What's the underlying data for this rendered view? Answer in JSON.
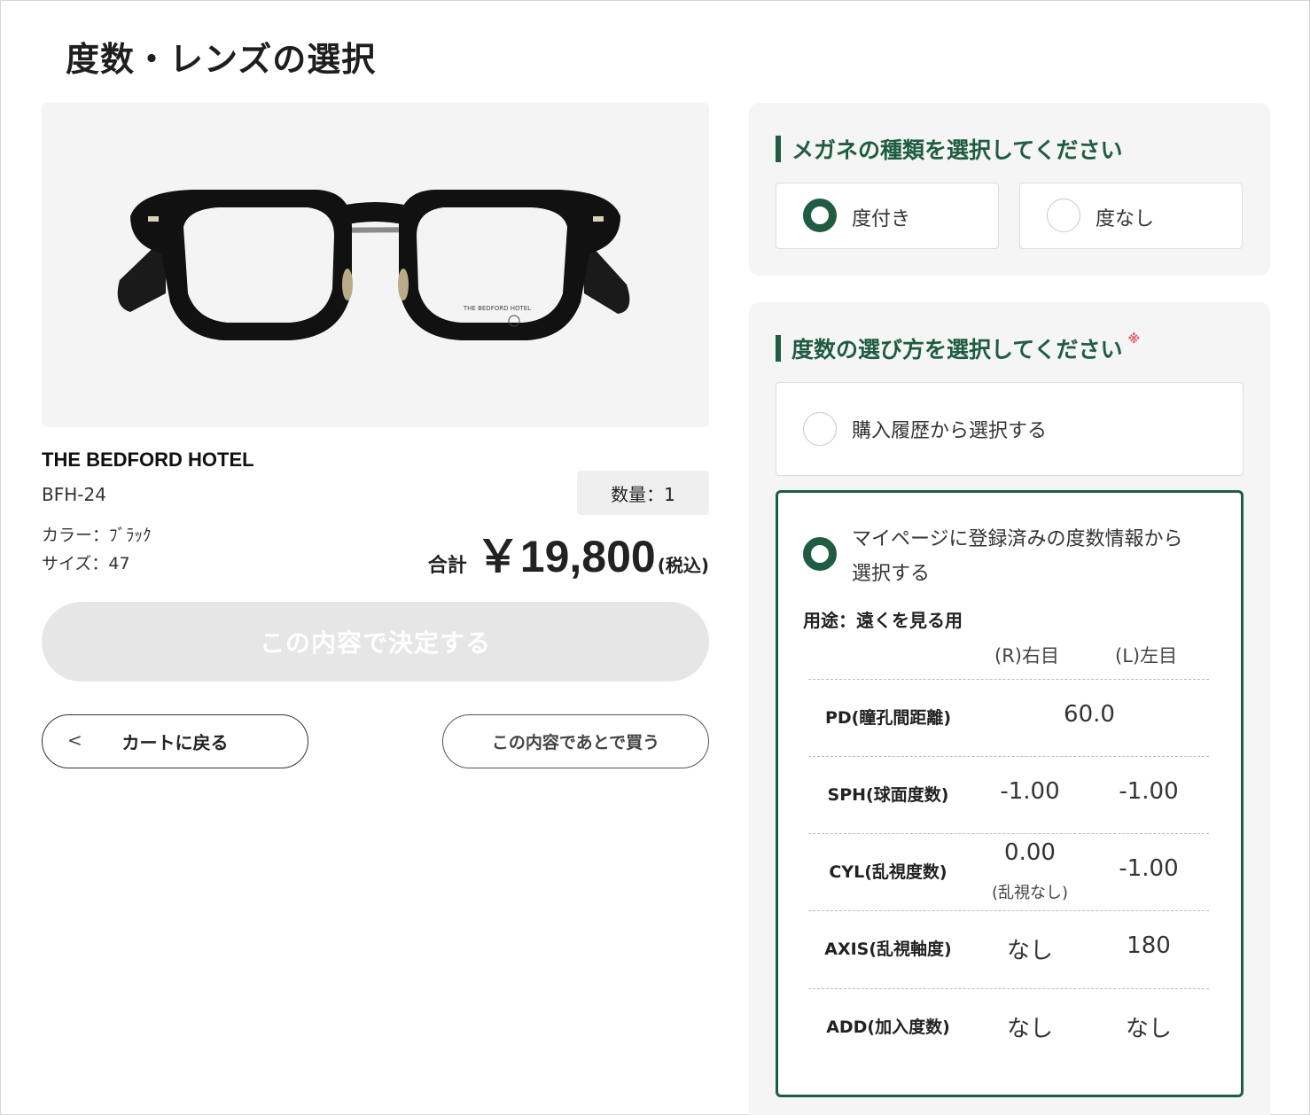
{
  "page": {
    "title": "度数・レンズの選択"
  },
  "product": {
    "image_logo_text": "THE BEDFORD HOTEL",
    "brand": "THE BEDFORD HOTEL",
    "model": "BFH-24",
    "color": "カラー：ﾌﾞﾗｯｸ",
    "size": "サイズ：47",
    "quantity": "数量：1",
    "price_label": "合計",
    "price": "￥19,800",
    "price_tax": "(税込)"
  },
  "actions": {
    "confirm_label": "この内容で決定する",
    "back_label": "カートに戻る",
    "back_chevron": "<",
    "buy_later_label": "この内容であとで買う"
  },
  "glasses_type": {
    "heading": "メガネの種類を選択してください",
    "options": [
      {
        "label": "度付き",
        "selected": true
      },
      {
        "label": "度なし",
        "selected": false
      }
    ]
  },
  "rx_method": {
    "heading": "度数の選び方を選択してください",
    "required_mark": "※",
    "options": [
      {
        "label": "購入履歴から選択する",
        "selected": false
      },
      {
        "label_line1": "マイページに登録済みの度数情報から",
        "label_line2": "選択する",
        "selected": true
      }
    ],
    "usage": "用途：遠くを見る用",
    "columns": {
      "right": "(R)右目",
      "left": "(L)左目"
    },
    "rows": [
      {
        "label": "PD(瞳孔間距離)",
        "value": "60.0"
      },
      {
        "label": "SPH(球面度数)",
        "right": "-1.00",
        "left": "-1.00"
      },
      {
        "label": "CYL(乱視度数)",
        "right": "0.00",
        "right_note": "(乱視なし)",
        "left": "-1.00"
      },
      {
        "label": "AXIS(乱視軸度)",
        "right": "なし",
        "left": "180"
      },
      {
        "label": "ADD(加入度数)",
        "right": "なし",
        "left": "なし"
      }
    ]
  },
  "colors": {
    "accent": "#1f5c42",
    "required": "#e05a5a",
    "disabled_button": "#e6e6e6"
  }
}
